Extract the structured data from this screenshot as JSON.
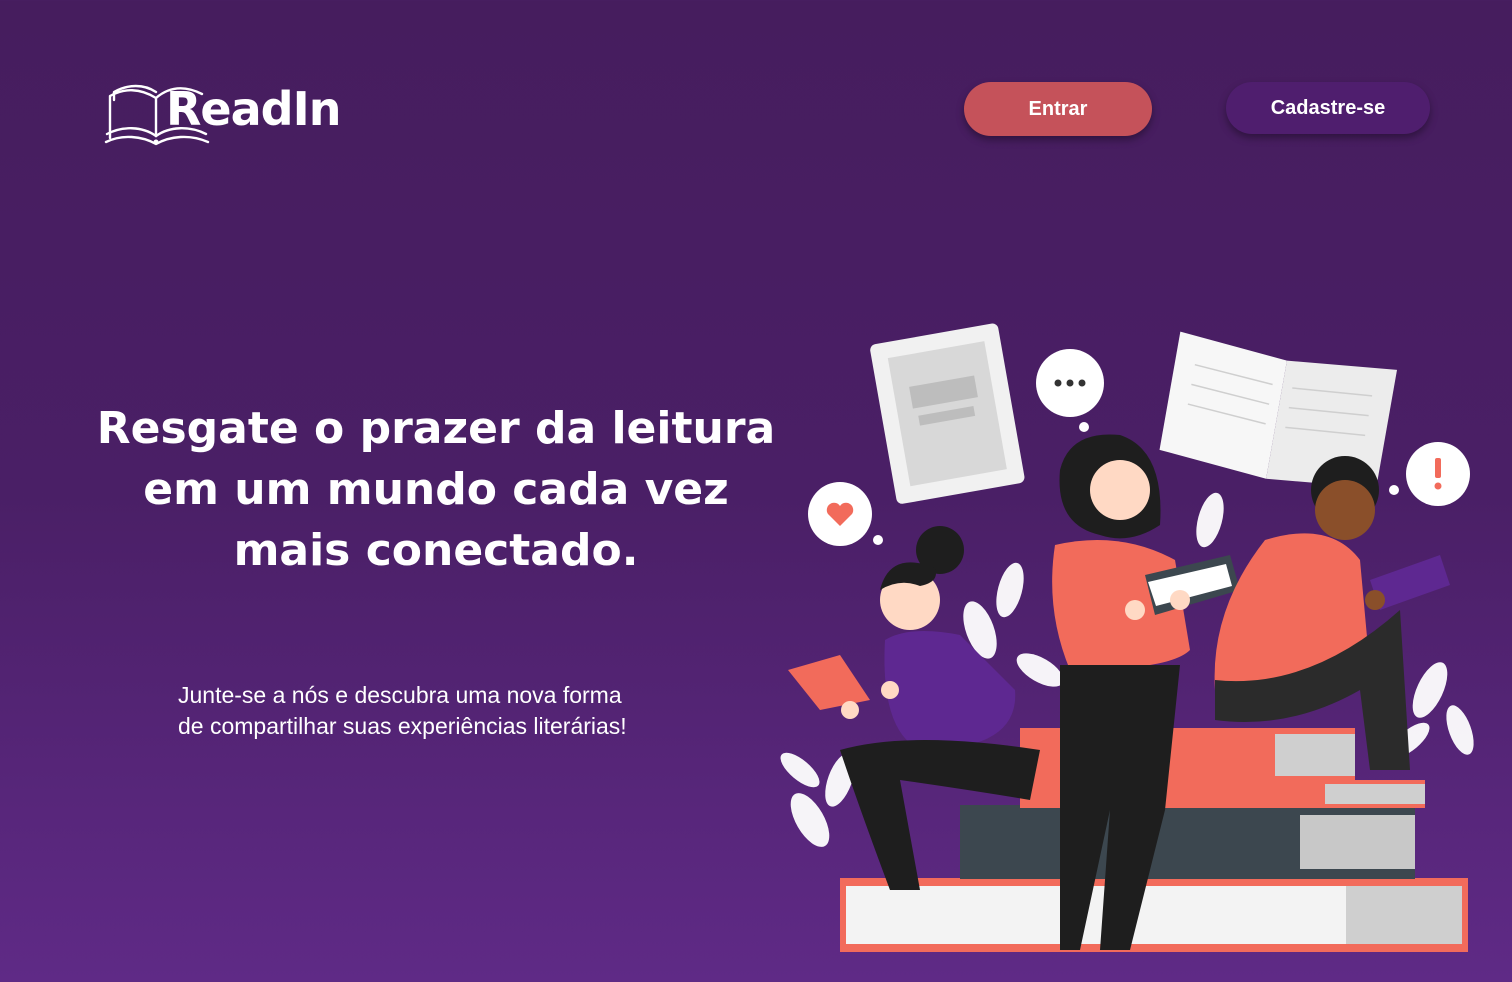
{
  "brand": {
    "name": "ReadIn",
    "icon": "open-book-icon"
  },
  "nav": {
    "login_label": "Entrar",
    "signup_label": "Cadastre-se"
  },
  "hero": {
    "headline_line1": "Resgate o prazer da leitura",
    "headline_line2": "em um mundo cada vez",
    "headline_line3": "mais conectado.",
    "subtitle_line1": "Junte-se a nós e descubra uma nova forma",
    "subtitle_line2": "de compartilhar suas experiências literárias!"
  },
  "colors": {
    "background_top": "#461d5e",
    "background_bottom": "#5f2a86",
    "login_button": "#c5525a",
    "signup_button": "#4f1e6e",
    "accent_coral": "#f26b5b",
    "text": "#ffffff"
  },
  "illustration": {
    "icons": [
      "heart-icon",
      "ellipsis-icon",
      "exclamation-icon"
    ]
  }
}
